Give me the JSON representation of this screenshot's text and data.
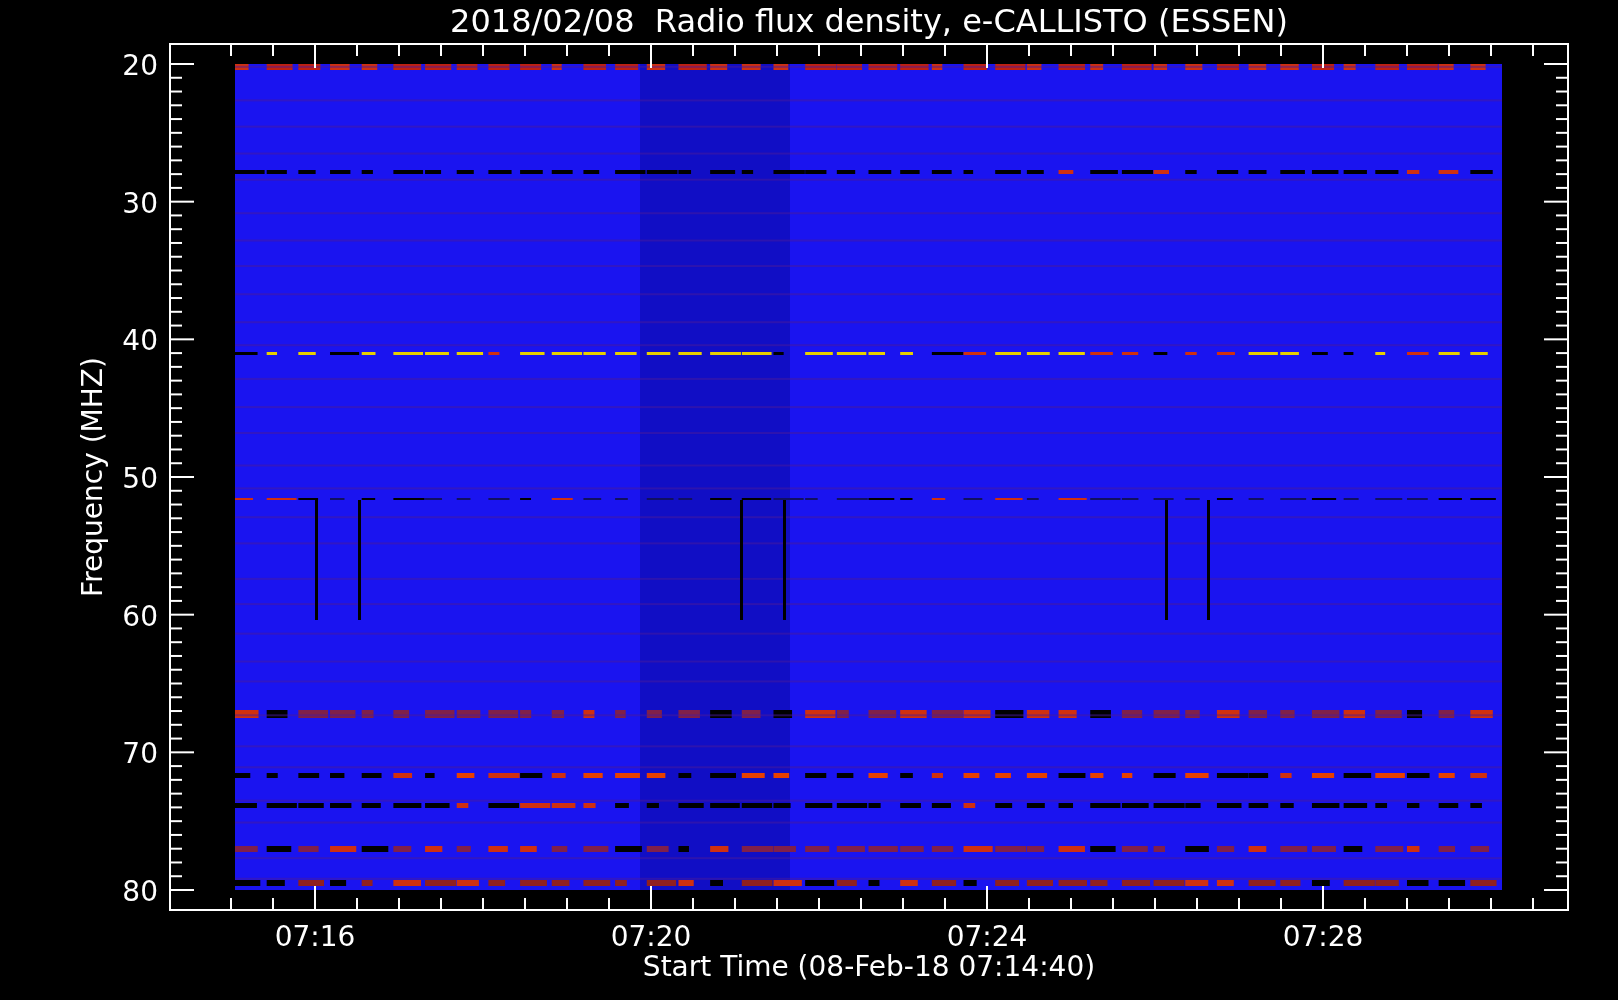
{
  "title": "2018/02/08  Radio flux density, e-CALLISTO (ESSEN)",
  "y_axis": {
    "label": "Frequency (MHZ)",
    "ticks": [
      "20",
      "30",
      "40",
      "50",
      "60",
      "70",
      "80"
    ]
  },
  "x_axis": {
    "label": "Start Time (08-Feb-18 07:14:40)",
    "ticks": [
      "07:16",
      "07:20",
      "07:24",
      "07:28"
    ]
  }
}
